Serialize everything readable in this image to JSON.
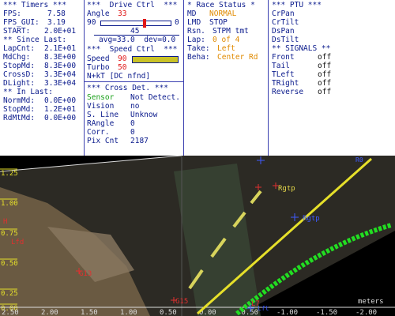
{
  "timers": {
    "header": "*** Timers ***",
    "fps_k": "FPS:",
    "fps_v": "7.58",
    "fpsgui_k": "FPS_GUI:",
    "fpsgui_v": "3.19",
    "start_k": "START:",
    "start_v": "2.0E+01",
    "since_hdr": "** Since Last:",
    "lapcnt_k": "LapCnt:",
    "lapcnt_v": "2.1E+01",
    "mdchg_k": "MdChg:",
    "mdchg_v": "8.3E+00",
    "stopmd_k": "StopMd:",
    "stopmd_v": "8.3E+00",
    "crossd_k": "CrossD:",
    "crossd_v": "3.3E+04",
    "dlight_k": "DLight:",
    "dlight_v": "3.3E+04",
    "in_hdr": "** In Last:",
    "normmd_k": "NormMd:",
    "normmd_v": "0.0E+00",
    "stopmd2_k": "StopMd:",
    "stopmd2_v": "1.2E+01",
    "rdmtmd_k": "RdMtMd:",
    "rdmtmd_v": "0.0E+00"
  },
  "drive": {
    "header": "***  Drive Ctrl  ***",
    "angle_label": "Angle",
    "angle_value": "33",
    "slider_min": "90",
    "slider_max": "0",
    "slider_pos": 0.63,
    "slider_mid": "45",
    "avg_dev": "avg=33.0  dev=0.0",
    "speed_hdr": "***  Speed Ctrl  ***",
    "speed_label": "Speed",
    "speed_value": "90",
    "speed_fill": 1.0,
    "turbo_label": "Turbo",
    "turbo_value": "50",
    "nkt": "N+kT [DC nfnd]",
    "cross_hdr": "*** Cross Det. ***",
    "sensor_k": "Sensor",
    "sensor_v": "Not Detect.",
    "vision_k": "Vision",
    "vision_v": "no",
    "sline_k": "S. Line",
    "sline_v": "Unknow",
    "rangle_k": "RAngle",
    "rangle_v": "0",
    "corr_k": "Corr.",
    "corr_v": "0",
    "pix_k": "Pix Cnt",
    "pix_v": "2187"
  },
  "race": {
    "header": "* Race Status *",
    "md_k": "MD",
    "md_v": "NORMAL",
    "lmd_k": "LMD",
    "lmd_v": "STOP",
    "rsn_k": "Rsn.",
    "rsn_v": "STPM tmt",
    "lap_k": "Lap:",
    "lap_v": "0 of 4",
    "take_k": "Take:",
    "take_v": "Left",
    "beha_k": "Beha:",
    "beha_v": "Center Rd"
  },
  "ptu": {
    "header": "*** PTU ***",
    "items": [
      "CrPan",
      "CrTilt",
      "DsPan",
      "DsTilt"
    ],
    "sig_hdr": "** SIGNALS **",
    "signals": [
      {
        "name": "Front",
        "state": "off"
      },
      {
        "name": "Tail",
        "state": "off"
      },
      {
        "name": "TLeft",
        "state": "off"
      },
      {
        "name": "TRight",
        "state": "off"
      },
      {
        "name": "Reverse",
        "state": "off"
      }
    ]
  },
  "view": {
    "y_ticks": [
      "1.25",
      "1.00",
      "0.75",
      "0.50",
      "0.25",
      "0.00"
    ],
    "x_ticks": [
      "2.50",
      "2.00",
      "1.50",
      "1.00",
      "0.50",
      "0.00",
      "-0.50",
      "-1.00",
      "-1.50",
      "-2.00"
    ],
    "units": "meters",
    "labels": {
      "rgtp": "Rgtp",
      "rgtp2": "Rgtp",
      "g13": "G13",
      "g15": "G15",
      "hcr": "H",
      "lfd": "Lfd",
      "l7": "L7",
      "lft": "Lft",
      "r0": "R0"
    }
  }
}
